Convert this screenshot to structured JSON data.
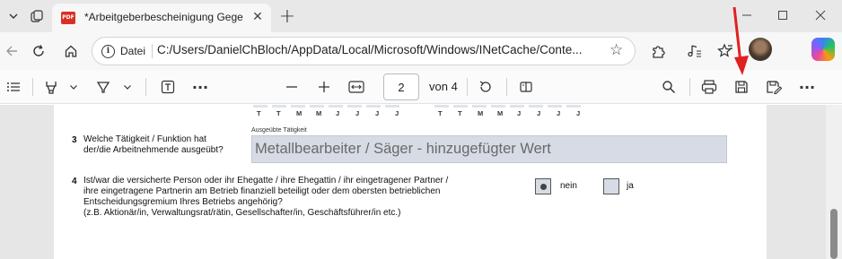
{
  "tab": {
    "favicon_label": "PDF",
    "title": "*Arbeitgeberbescheinigung Gege"
  },
  "address": {
    "info_label": "Datei",
    "url": "C:/Users/DanielChBloch/AppData/Local/Microsoft/Windows/INetCache/Conte..."
  },
  "pdf_toolbar": {
    "page_current": "2",
    "page_of": "von 4"
  },
  "document": {
    "date_letters_left": [
      "T",
      "T",
      "M",
      "M",
      "J",
      "J",
      "J",
      "J"
    ],
    "date_letters_right": [
      "T",
      "T",
      "M",
      "M",
      "J",
      "J",
      "J",
      "J"
    ],
    "q3": {
      "number": "3",
      "text_line1": "Welche Tätigkeit / Funktion hat",
      "text_line2": "der/die Arbeitnehmende ausgeübt?",
      "field_caption": "Ausgeübte Tätigkeit",
      "field_value": "Metallbearbeiter / Säger - hinzugefügter Wert"
    },
    "q4": {
      "number": "4",
      "lines": [
        "Ist/war die versicherte Person oder ihr Ehegatte / ihre Ehegattin / ihr eingetragener Partner /",
        "ihre eingetragene Partnerin am Betrieb finanziell beteiligt oder dem obersten betrieblichen",
        "Entscheidungsgremium Ihres Betriebs angehörig?",
        "(z.B. Aktionär/in, Verwaltungsrat/rätin, Gesellschafter/in, Geschäftsführer/in etc.)"
      ],
      "option_nein": "nein",
      "option_ja": "ja",
      "selected": "nein"
    }
  },
  "colors": {
    "annotation_arrow": "#e02020",
    "form_field_fill": "#d6dbe5"
  }
}
